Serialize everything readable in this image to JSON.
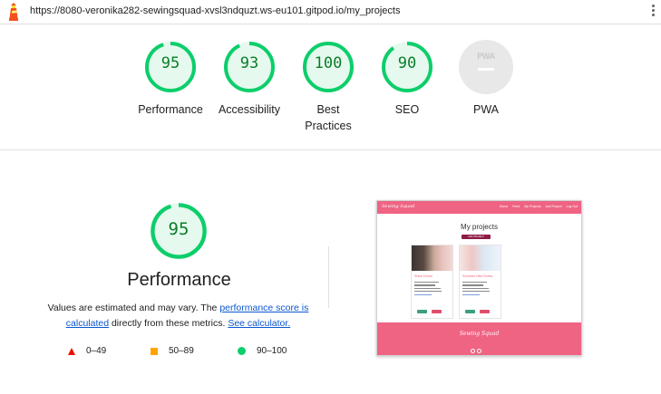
{
  "browser": {
    "url": "https://8080-veronika282-sewingsquad-xvsl3ndquzt.ws-eu101.gitpod.io/my_projects"
  },
  "summary": [
    {
      "label": "Performance",
      "score": "95",
      "value": 95
    },
    {
      "label": "Accessibility",
      "score": "93",
      "value": 93
    },
    {
      "label": "Best Practices",
      "label_line1": "Best",
      "label_line2": "Practices",
      "score": "100",
      "value": 100
    },
    {
      "label": "SEO",
      "score": "90",
      "value": 90
    },
    {
      "label": "PWA",
      "badge": "PWA"
    }
  ],
  "performance": {
    "score": "95",
    "value": 95,
    "title": "Performance",
    "note_prefix": "Values are estimated and may vary. The ",
    "note_link1": "performance score is calculated",
    "note_middle": " directly from these metrics. ",
    "note_link2": "See calculator."
  },
  "legend": [
    {
      "range": "0–49",
      "icon": "red-triangle-icon"
    },
    {
      "range": "50–89",
      "icon": "orange-square-icon"
    },
    {
      "range": "90–100",
      "icon": "green-circle-icon"
    }
  ],
  "colors": {
    "pass": "#0cce6b",
    "pass_text": "#0a7e29",
    "pass_bg": "#e6f9ee",
    "average": "#ffa400",
    "fail": "#eb0f00",
    "site_brand": "#ef6383"
  },
  "thumbnail": {
    "brand": "Sewing Squad",
    "nav_links": [
      "Home",
      "Feed",
      "My Projects",
      "Add Project",
      "Log Out"
    ],
    "heading": "My projects",
    "add_button": "ADD PROJECT",
    "cards": [
      {
        "title": "Shea Dress"
      },
      {
        "title": "Summer Mini Dress"
      }
    ]
  }
}
